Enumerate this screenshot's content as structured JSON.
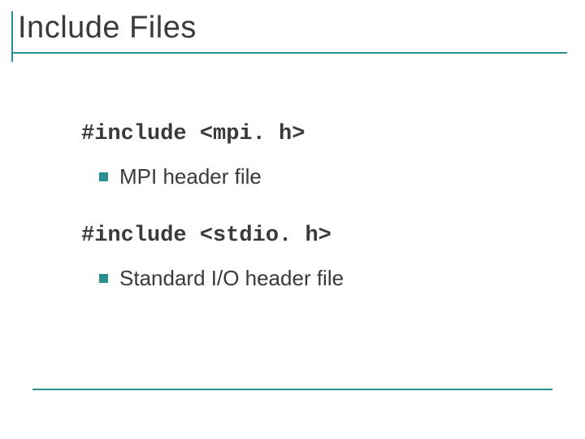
{
  "title": "Include Files",
  "items": [
    {
      "code": "#include <mpi. h>",
      "desc": "MPI header file"
    },
    {
      "code": "#include <stdio. h>",
      "desc": "Standard I/O header file"
    }
  ]
}
